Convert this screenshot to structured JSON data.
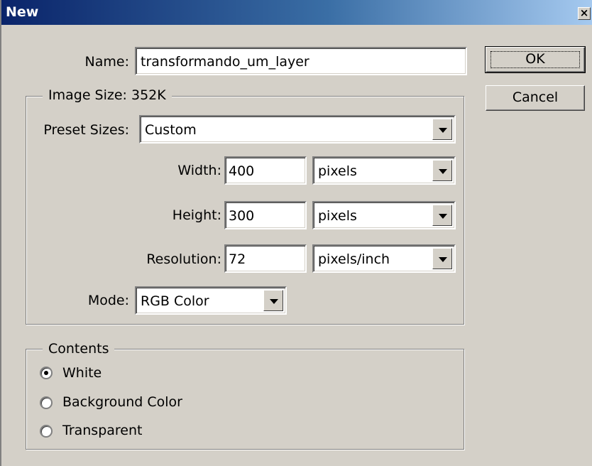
{
  "window": {
    "title": "New",
    "close_glyph": "×"
  },
  "name": {
    "label": "Name:",
    "value": "transformando_um_layer"
  },
  "buttons": {
    "ok": "OK",
    "cancel": "Cancel"
  },
  "image_size": {
    "legend": "Image Size: 352K",
    "preset_label": "Preset Sizes:",
    "preset_value": "Custom",
    "width_label": "Width:",
    "width_value": "400",
    "width_unit": "pixels",
    "height_label": "Height:",
    "height_value": "300",
    "height_unit": "pixels",
    "resolution_label": "Resolution:",
    "resolution_value": "72",
    "resolution_unit": "pixels/inch",
    "mode_label": "Mode:",
    "mode_value": "RGB Color"
  },
  "contents": {
    "legend": "Contents",
    "options": [
      {
        "label": "White",
        "selected": true
      },
      {
        "label": "Background Color",
        "selected": false
      },
      {
        "label": "Transparent",
        "selected": false
      }
    ]
  }
}
